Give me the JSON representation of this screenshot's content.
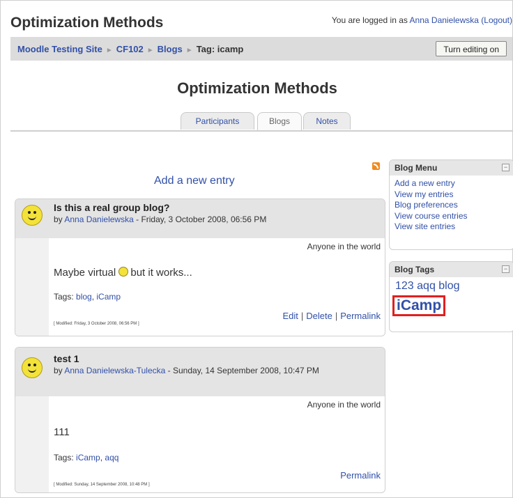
{
  "header": {
    "site_title": "Optimization Methods",
    "login_prefix": "You are logged in as",
    "user_name": "Anna Danielewska",
    "logout_label": "(Logout)"
  },
  "breadcrumb": {
    "items": [
      "Moodle Testing Site",
      "CF102",
      "Blogs"
    ],
    "current": "Tag: icamp"
  },
  "toolbar": {
    "edit_label": "Turn editing on"
  },
  "page": {
    "course_title": "Optimization Methods"
  },
  "tabs": [
    {
      "label": "Participants",
      "selected": false
    },
    {
      "label": "Blogs",
      "selected": true
    },
    {
      "label": "Notes",
      "selected": false
    }
  ],
  "main": {
    "add_entry_label": "Add a new entry"
  },
  "posts": [
    {
      "title": "Is this a real group blog?",
      "by_prefix": "by",
      "author": "Anna Danielewska",
      "date": "- Friday, 3 October 2008, 06:56 PM",
      "audience": "Anyone in the world",
      "body": "Maybe virtual",
      "body_suffix": "but it works...",
      "tags_prefix": "Tags:",
      "tags": [
        "blog",
        "iCamp"
      ],
      "modified": "[ Modified: Friday, 3 October 2008, 06:56 PM ]",
      "actions": [
        "Edit",
        "Delete",
        "Permalink"
      ]
    },
    {
      "title": "test 1",
      "by_prefix": "by",
      "author": "Anna Danielewska-Tulecka",
      "date": "- Sunday, 14 September 2008, 10:47 PM",
      "audience": "Anyone in the world",
      "body": "111",
      "tags_prefix": "Tags:",
      "tags": [
        "iCamp",
        "aqq"
      ],
      "modified": "[ Modified: Sunday, 14 September 2008, 10:48 PM ]",
      "actions": [
        "Permalink"
      ]
    }
  ],
  "blog_menu": {
    "title": "Blog Menu",
    "items": [
      "Add a new entry",
      "View my entries",
      "Blog preferences",
      "View course entries",
      "View site entries"
    ]
  },
  "blog_tags": {
    "title": "Blog Tags",
    "tag_small": "123 aqq blog",
    "tag_big": "iCamp"
  },
  "colors": {
    "link": "#3150a8",
    "highlight_border": "#e01f1f",
    "header_bg": "#dcdcdc"
  },
  "icons": [
    "rss-icon",
    "avatar-smiley",
    "emoticon",
    "collapse-icon"
  ]
}
